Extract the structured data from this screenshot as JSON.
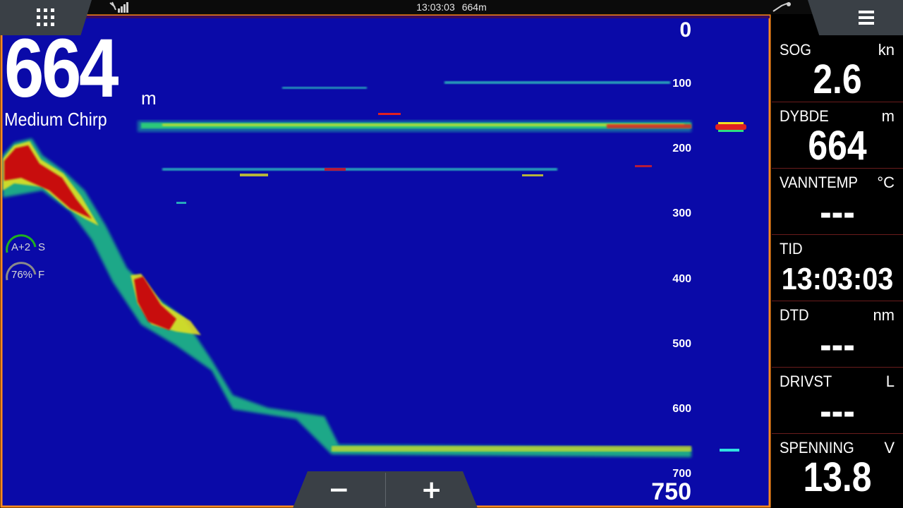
{
  "status_bar": {
    "time": "13:03:03",
    "depth": "664m",
    "signal_icon": "signal-bars-icon",
    "satellite_icon": "satellite-icon"
  },
  "menus": {
    "apps_icon": "grid-apps-icon",
    "menu_icon": "hamburger-menu-icon"
  },
  "sonar": {
    "depth_value": "664",
    "depth_unit": "m",
    "mode": "Medium Chirp",
    "gain": {
      "value": "A+2",
      "mode": "S"
    },
    "color": {
      "value": "76%",
      "mode": "F"
    },
    "scale_labels": [
      "0",
      "100",
      "200",
      "300",
      "400",
      "500",
      "600",
      "700"
    ],
    "range": "750",
    "colors": {
      "background": "#0a0aa8",
      "frame": "#ff8a1c",
      "strong": "#d01010",
      "medium": "#ffe020",
      "weak": "#20e080"
    }
  },
  "zoom": {
    "minus": "−",
    "plus": "+"
  },
  "data_panel": [
    {
      "label": "SOG",
      "unit": "kn",
      "value": "2.6"
    },
    {
      "label": "DYBDE",
      "unit": "m",
      "value": "664"
    },
    {
      "label": "VANNTEMP",
      "unit": "°C",
      "value": "---"
    },
    {
      "label": "TID",
      "unit": "",
      "value": "13:03:03"
    },
    {
      "label": "DTD",
      "unit": "nm",
      "value": "---"
    },
    {
      "label": "DRIVST",
      "unit": "L",
      "value": "---"
    },
    {
      "label": "SPENNING",
      "unit": "V",
      "value": "13.8"
    }
  ]
}
